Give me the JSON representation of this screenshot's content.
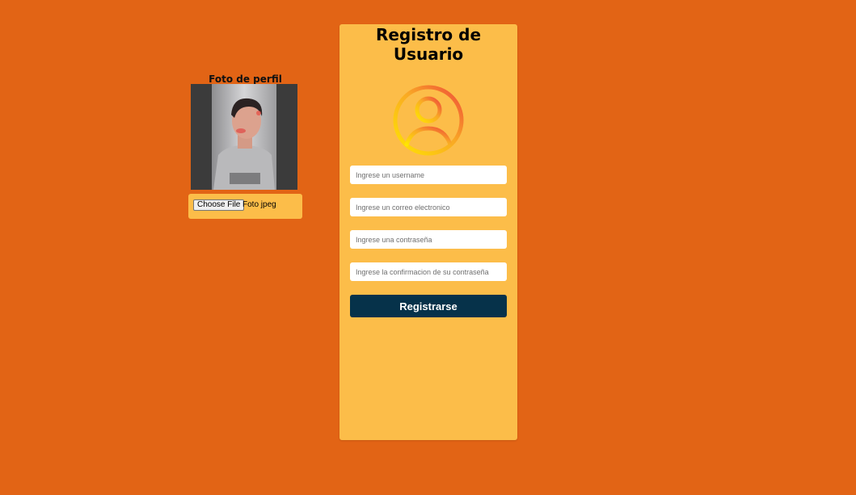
{
  "profile_photo": {
    "title": "Foto de perfil",
    "file_button_label": "Choose File",
    "file_name": "Foto jpeg"
  },
  "form": {
    "title": "Registro de Usuario",
    "avatar_icon": "user-circle-icon",
    "fields": {
      "username_placeholder": "Ingrese un username",
      "email_placeholder": "Ingrese un correo electronico",
      "password_placeholder": "Ingrese una contraseña",
      "confirm_placeholder": "Ingrese la confirmacion de su contraseña"
    },
    "submit_label": "Registrarse"
  },
  "colors": {
    "background": "#e26415",
    "card": "#fcbd49",
    "button": "#06324a"
  }
}
